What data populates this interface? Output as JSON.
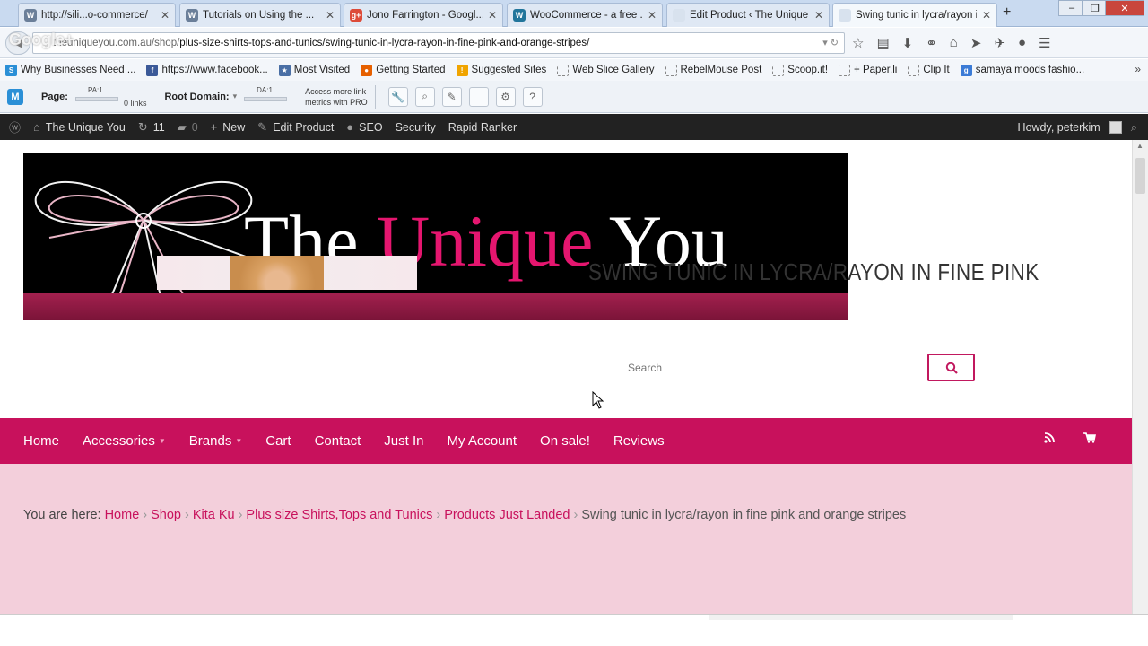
{
  "tabs": [
    {
      "label": "http://sili...o-commerce/",
      "fav": "W",
      "color": "#6b7f99"
    },
    {
      "label": "Tutorials on Using the ...",
      "fav": "W",
      "color": "#6b7f99"
    },
    {
      "label": "Jono Farrington - Googl...",
      "fav": "g+",
      "color": "#dd4b39"
    },
    {
      "label": "WooCommerce - a free ...",
      "fav": "W",
      "color": "#21759b"
    },
    {
      "label": "Edit Product ‹ The Unique Y...",
      "fav": "",
      "color": "#d8e2ee"
    },
    {
      "label": "Swing tunic in lycra/rayon i...",
      "fav": "",
      "color": "#d8e2ee"
    }
  ],
  "address": {
    "prefix": "theuniqueyou.com.au/shop/",
    "path": "plus-size-shirts-tops-and-tunics/swing-tunic-in-lycra-rayon-in-fine-pink-and-orange-stripes/"
  },
  "overlay": "Google+",
  "bookmarks": [
    {
      "label": "Why Businesses Need ...",
      "icon": "S",
      "color": "#2a8fd6"
    },
    {
      "label": "https://www.facebook...",
      "icon": "f",
      "color": "#3b5998"
    },
    {
      "label": "Most Visited",
      "icon": "★",
      "color": "#4a6fa5"
    },
    {
      "label": "Getting Started",
      "icon": "●",
      "color": "#e66000"
    },
    {
      "label": "Suggested Sites",
      "icon": "!",
      "color": "#f0a400"
    },
    {
      "label": "Web Slice Gallery",
      "icon": "",
      "color": "box"
    },
    {
      "label": "RebelMouse Post",
      "icon": "",
      "color": "box"
    },
    {
      "label": "Scoop.it!",
      "icon": "",
      "color": "box"
    },
    {
      "label": "+ Paper.li",
      "icon": "",
      "color": "box"
    },
    {
      "label": "Clip It",
      "icon": "",
      "color": "box"
    },
    {
      "label": "samaya moods fashio...",
      "icon": "g",
      "color": "#3b7bd6"
    }
  ],
  "mozbar": {
    "page_label": "Page:",
    "pa": "PA:1",
    "links": "0 links",
    "root_label": "Root Domain:",
    "da": "DA:1",
    "pro_line1": "Access more link",
    "pro_line2": "metrics with PRO"
  },
  "adminbar": {
    "site": "The Unique You",
    "updates": "11",
    "comments": "0",
    "new": "New",
    "edit": "Edit Product",
    "seo": "SEO",
    "security": "Security",
    "rapid": "Rapid Ranker",
    "howdy": "Howdy, peterkim"
  },
  "banner": {
    "word1": "The",
    "word2": "Unique",
    "word3": "You"
  },
  "search": {
    "placeholder": "Search"
  },
  "nav": [
    {
      "label": "Home",
      "caret": false
    },
    {
      "label": "Accessories",
      "caret": true
    },
    {
      "label": "Brands",
      "caret": true
    },
    {
      "label": "Cart",
      "caret": false
    },
    {
      "label": "Contact",
      "caret": false
    },
    {
      "label": "Just In",
      "caret": false
    },
    {
      "label": "My Account",
      "caret": false
    },
    {
      "label": "On sale!",
      "caret": false
    },
    {
      "label": "Reviews",
      "caret": false
    }
  ],
  "breadcrumb": {
    "lead": "You are here:",
    "links": [
      "Home",
      "Shop",
      "Kita Ku",
      "Plus size Shirts,Tops and Tunics",
      "Products Just Landed"
    ],
    "current": "Swing tunic in lycra/rayon in fine pink and orange stripes"
  },
  "product": {
    "title": "SWING TUNIC IN LYCRA/RAYON IN FINE PINK"
  },
  "colors": {
    "brand_pink": "#c8115c",
    "banner_pink": "#e5166f",
    "pink_bg": "#f3cfdb"
  }
}
